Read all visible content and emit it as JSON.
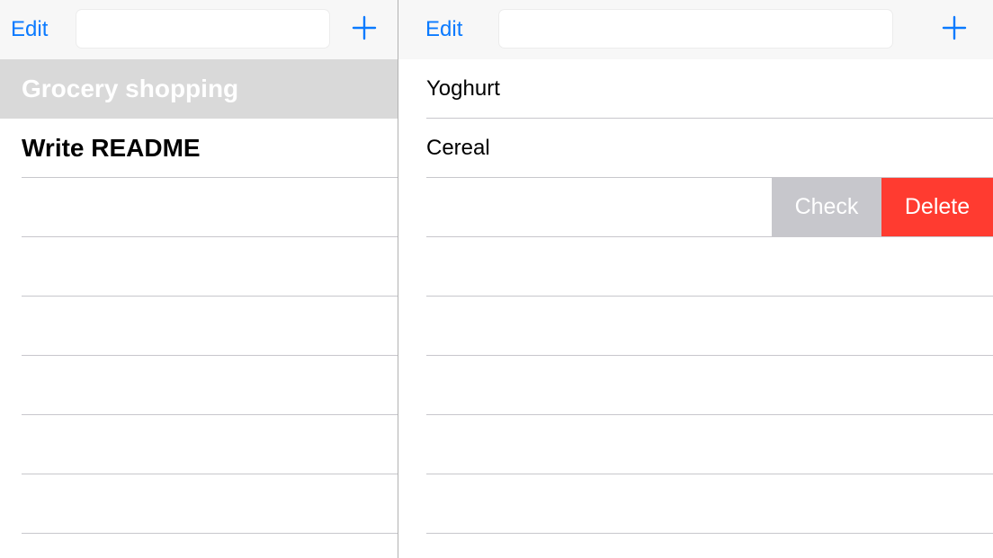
{
  "colors": {
    "accent": "#0a7aff",
    "selected_row_bg": "#d9d9d9",
    "separator": "#c8c7cc",
    "check_action": "#c7c7cc",
    "delete_action": "#ff3b30"
  },
  "left_pane": {
    "navbar": {
      "edit_label": "Edit",
      "search_placeholder": "",
      "add_icon": "plus-icon"
    },
    "items": [
      {
        "label": "Grocery shopping",
        "selected": true
      },
      {
        "label": "Write README",
        "selected": false
      }
    ]
  },
  "right_pane": {
    "navbar": {
      "edit_label": "Edit",
      "search_placeholder": "",
      "add_icon": "plus-icon"
    },
    "items": [
      {
        "label": "Yoghurt"
      },
      {
        "label": "Cereal"
      }
    ],
    "swipe_actions": {
      "check_label": "Check",
      "delete_label": "Delete"
    }
  }
}
